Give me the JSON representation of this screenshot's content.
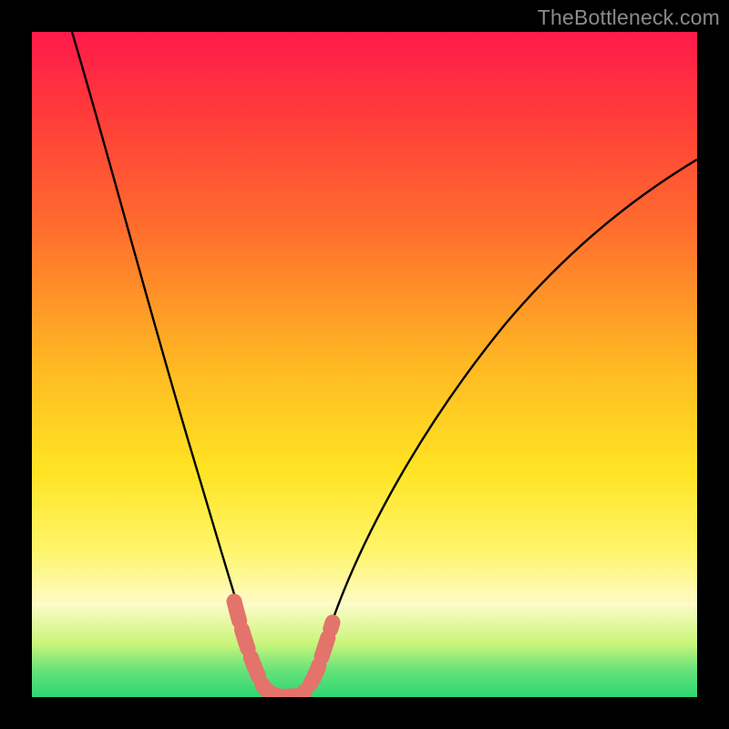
{
  "watermark": "TheBottleneck.com",
  "colors": {
    "background": "#000000",
    "gradient_top": "#ff1a4b",
    "gradient_bottom": "#2fd673",
    "curve_stroke": "#000000",
    "highlight_stroke": "#e3736b"
  },
  "chart_data": {
    "type": "line",
    "title": "",
    "xlabel": "",
    "ylabel": "",
    "xlim": [
      0,
      100
    ],
    "ylim": [
      0,
      100
    ],
    "series": [
      {
        "name": "bottleneck-curve",
        "x": [
          6,
          10,
          15,
          20,
          25,
          28,
          30,
          32,
          34,
          36,
          38,
          40,
          45,
          55,
          65,
          75,
          85,
          95,
          100
        ],
        "y": [
          100,
          85,
          68,
          52,
          35,
          22,
          14,
          7,
          2,
          0,
          0,
          2,
          11,
          28,
          42,
          53,
          62,
          70,
          73
        ]
      }
    ],
    "annotations": [
      {
        "name": "highlight-segment",
        "x_range": [
          29,
          41
        ],
        "note": "thick pink overlay near minimum"
      }
    ]
  }
}
